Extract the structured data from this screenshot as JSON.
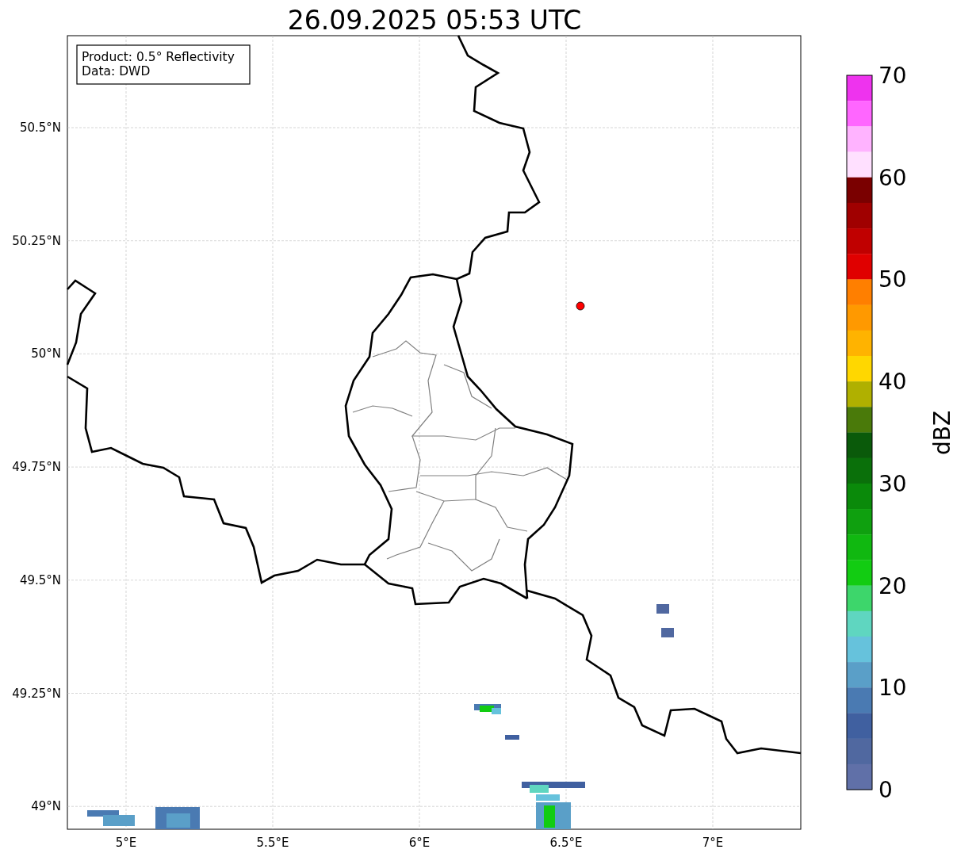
{
  "title": "26.09.2025 05:53 UTC",
  "info_box": {
    "lines": [
      "Product: 0.5° Reflectivity",
      "Data: DWD"
    ]
  },
  "map": {
    "lat_labels": [
      "50.5°N",
      "50.25°N",
      "50°N",
      "49.75°N",
      "49.5°N",
      "49.25°N",
      "49°N"
    ],
    "lon_labels": [
      "5°E",
      "5.5°E",
      "6°E",
      "6.5°E",
      "7°E"
    ]
  },
  "colorbar": {
    "label": "dBZ",
    "ticks": [
      "70",
      "60",
      "50",
      "40",
      "30",
      "20",
      "10",
      "0"
    ],
    "bins": [
      {
        "color": "#ee33ee"
      },
      {
        "color": "#ff66ff"
      },
      {
        "color": "#ffb3ff"
      },
      {
        "color": "#ffe0ff"
      },
      {
        "color": "#7a0000"
      },
      {
        "color": "#a00000"
      },
      {
        "color": "#c00000"
      },
      {
        "color": "#e00000"
      },
      {
        "color": "#ff7f00"
      },
      {
        "color": "#ff9900"
      },
      {
        "color": "#ffb300"
      },
      {
        "color": "#ffd700"
      },
      {
        "color": "#b0b000"
      },
      {
        "color": "#4a7a0a"
      },
      {
        "color": "#0a5a0a"
      },
      {
        "color": "#0a700a"
      },
      {
        "color": "#0a8a0a"
      },
      {
        "color": "#0fa00f"
      },
      {
        "color": "#10b810"
      },
      {
        "color": "#12cc12"
      },
      {
        "color": "#3dd66b"
      },
      {
        "color": "#5fd6c0"
      },
      {
        "color": "#66c2dc"
      },
      {
        "color": "#5a9fc8"
      },
      {
        "color": "#4a7ab2"
      },
      {
        "color": "#4060a0"
      },
      {
        "color": "#5068a0"
      },
      {
        "color": "#6070a8"
      }
    ]
  }
}
